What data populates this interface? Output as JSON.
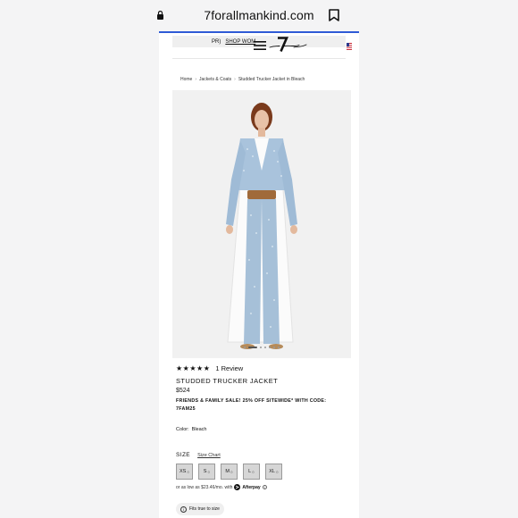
{
  "browser": {
    "url": "7forallmankind.com",
    "icons": {
      "lock": "lock-icon",
      "bookmark": "bookmark-icon"
    },
    "load_color": "#2f5bd6"
  },
  "header": {
    "promo_prefix": "PR)",
    "promo_link": "SHOP WOM",
    "icons": {
      "menu": "hamburger-icon",
      "logo": "7-for-all-mankind-logo",
      "region": "us-flag-icon"
    }
  },
  "breadcrumb": {
    "items": [
      "Home",
      "Jackets & Coats",
      "Studded Trucker Jacket in Bleach"
    ],
    "separator": "›"
  },
  "product": {
    "image_dots": 7,
    "active_dot": 1,
    "stars": "★★★★★",
    "rating": 5,
    "review_count": "1 Review",
    "title": "STUDDED TRUCKER JACKET",
    "price": "$524",
    "promo": "FRIENDS & FAMILY SALE! 25% OFF SITEWIDE* WITH CODE: 7FAM25",
    "color_label": "Color:",
    "color_value": "Bleach",
    "size_label": "SIZE",
    "size_chart": "Size Chart",
    "sizes": [
      "XS",
      "S",
      "M",
      "L",
      "XL"
    ],
    "afterpay_text": "or as low as $23.46/mo. with",
    "afterpay_brand": "Afterpay",
    "fit": "Fits true to size"
  }
}
